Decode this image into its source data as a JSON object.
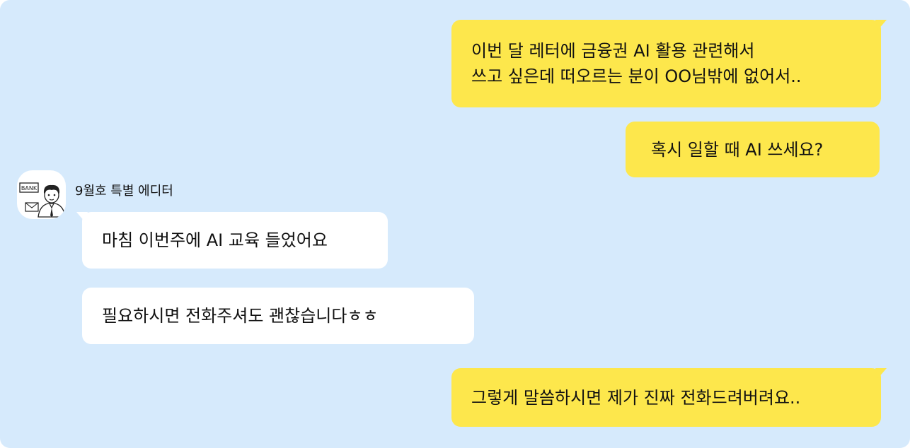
{
  "messages": [
    {
      "line1": "이번 달 레터에 금융권 AI 활용 관련해서",
      "line2": "쓰고 싶은데 떠오르는 분이 OO님밖에 없어서.."
    },
    {
      "text": "혹시 일할 때 AI 쓰세요?"
    },
    {
      "text": "마침 이번주에 AI 교육 들었어요"
    },
    {
      "text": "필요하시면 전화주셔도 괜찮습니다ㅎㅎ"
    },
    {
      "text": "그렇게 말씀하시면 제가 진짜 전화드려버려요.."
    }
  ],
  "sender": {
    "name": "9월호 특별 에디터",
    "avatar_sign": "BANK"
  },
  "colors": {
    "background": "#d6eafc",
    "my_bubble": "#fde74c",
    "their_bubble": "#ffffff"
  }
}
